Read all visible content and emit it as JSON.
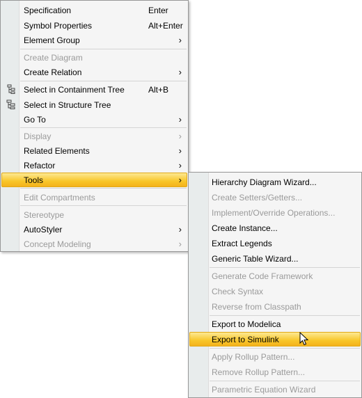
{
  "main_menu": {
    "items": [
      {
        "label": "Specification",
        "shortcut": "Enter"
      },
      {
        "label": "Symbol Properties",
        "shortcut": "Alt+Enter"
      },
      {
        "label": "Element Group",
        "submenu": "›"
      },
      {
        "label": "Create Diagram"
      },
      {
        "label": "Create Relation",
        "submenu": "›"
      },
      {
        "label": "Select in Containment Tree",
        "shortcut": "Alt+B",
        "icon": "containment-tree-icon"
      },
      {
        "label": "Select in Structure Tree",
        "icon": "structure-tree-icon"
      },
      {
        "label": "Go To",
        "submenu": "›"
      },
      {
        "label": "Display",
        "submenu": "›"
      },
      {
        "label": "Related Elements",
        "submenu": "›"
      },
      {
        "label": "Refactor",
        "submenu": "›"
      },
      {
        "label": "Tools",
        "submenu": "›"
      },
      {
        "label": "Edit Compartments"
      },
      {
        "label": "Stereotype"
      },
      {
        "label": "AutoStyler",
        "submenu": "›"
      },
      {
        "label": "Concept Modeling",
        "submenu": "›"
      }
    ]
  },
  "tools_menu": {
    "items": [
      {
        "label": "Hierarchy Diagram Wizard..."
      },
      {
        "label": "Create Setters/Getters..."
      },
      {
        "label": "Implement/Override Operations..."
      },
      {
        "label": "Create Instance..."
      },
      {
        "label": "Extract Legends"
      },
      {
        "label": "Generic Table Wizard..."
      },
      {
        "label": "Generate Code Framework"
      },
      {
        "label": "Check Syntax"
      },
      {
        "label": "Reverse from Classpath"
      },
      {
        "label": "Export to Modelica"
      },
      {
        "label": "Export to Simulink"
      },
      {
        "label": "Apply Rollup Pattern..."
      },
      {
        "label": "Remove Rollup Pattern..."
      },
      {
        "label": "Parametric Equation Wizard"
      }
    ]
  },
  "colors": {
    "highlight": "#f8c62a",
    "disabled_text": "#9a9a9a",
    "menu_bg": "#f5f5f5"
  }
}
